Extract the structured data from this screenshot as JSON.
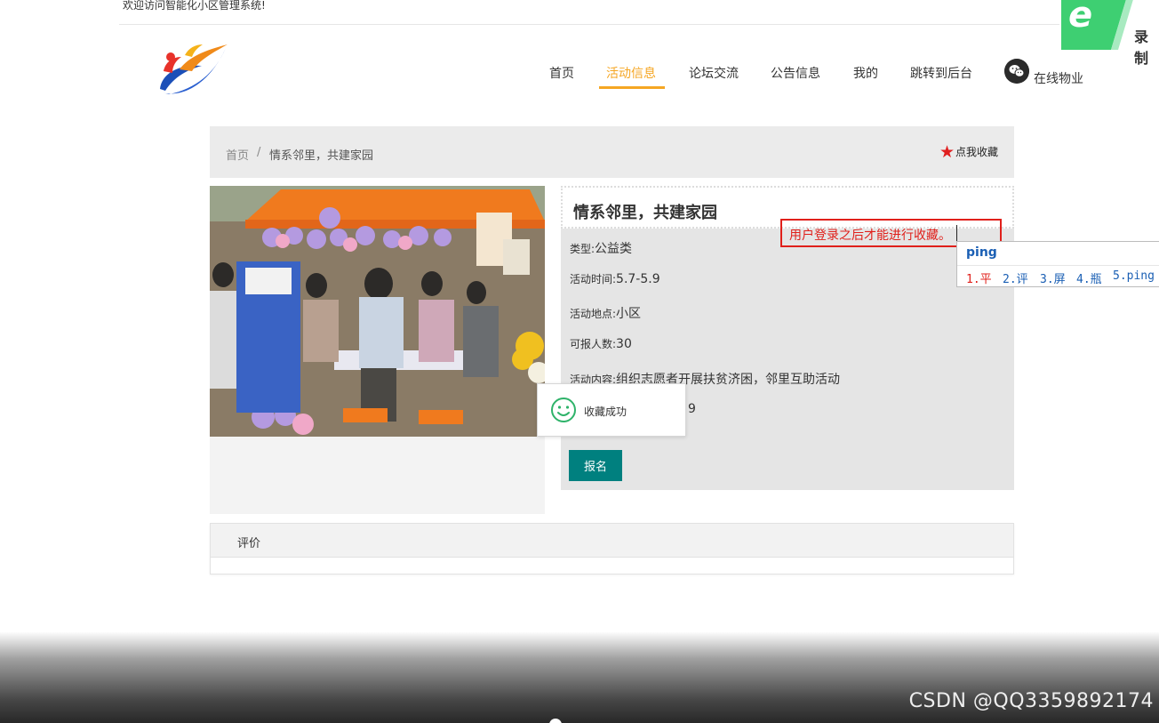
{
  "header": {
    "welcome_text": "欢迎访问智能化小区管理系统!"
  },
  "nav": {
    "items": [
      {
        "label": "首页",
        "active": false
      },
      {
        "label": "活动信息",
        "active": true
      },
      {
        "label": "论坛交流",
        "active": false
      },
      {
        "label": "公告信息",
        "active": false
      },
      {
        "label": "我的",
        "active": false
      },
      {
        "label": "跳转到后台",
        "active": false
      }
    ],
    "online_service": "在线物业",
    "accent_color": "#f5a623"
  },
  "breadcrumb": {
    "home": "首页",
    "separator": "/",
    "current": "情系邻里，共建家园",
    "favorite_label": "点我收藏"
  },
  "activity": {
    "title": "情系邻里，共建家园",
    "type_label": "类型:",
    "type_value": "公益类",
    "time_label": "活动时间:",
    "time_value": "5.7-5.9",
    "place_label": "活动地点:",
    "place_value": "小区",
    "quota_label": "可报人数:",
    "quota_value": "30",
    "content_label": "活动内容:",
    "content_value": "组织志愿者开展扶贫济困，邻里互助活动",
    "partial_value": "9",
    "signup_label": "报名"
  },
  "toast": {
    "message": "收藏成功",
    "icon": "smile-icon"
  },
  "tooltip": {
    "message": "用户登录之后才能进行收藏。"
  },
  "ime": {
    "composition": "ping",
    "candidates": [
      "1.平",
      "2.评",
      "3.屏",
      "4.瓶",
      "5.ping"
    ]
  },
  "review": {
    "title": "评价"
  },
  "recorder": {
    "label": "录制"
  },
  "watermark": {
    "text": "CSDN @QQ3359892174"
  }
}
